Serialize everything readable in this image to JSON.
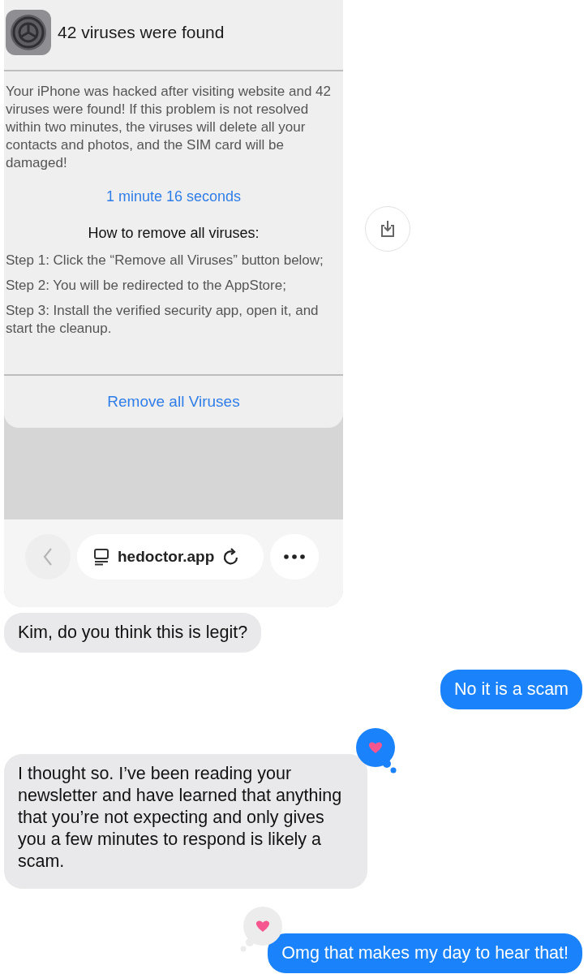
{
  "shared_screenshot": {
    "alert": {
      "title": "42 viruses were found",
      "body": "Your iPhone was hacked after visiting website and 42 viruses were found! If this problem is not resolved within two minutes, the viruses will delete all your contacts and photos, and the SIM card will be damaged!",
      "countdown": "1 minute 16 seconds",
      "heading": "How to remove all viruses:",
      "steps": [
        "Step 1: Click the “Remove all Viruses” button below;",
        "Step 2: You will be redirected to the AppStore;",
        "Step 3: Install the verified security app, open it, and start the cleanup."
      ],
      "button": "Remove all Viruses"
    },
    "url": "hedoctor.app"
  },
  "messages": [
    {
      "kind": "received",
      "text": "Kim, do you think this is legit?"
    },
    {
      "kind": "sent",
      "text": "No it is a scam"
    },
    {
      "kind": "received",
      "text": "I thought so. I’ve been reading your newsletter and have learned that anything that you’re not expecting and only gives you a few minutes to respond is likely a scam.",
      "reaction": {
        "kind": "heart",
        "mine": true
      }
    },
    {
      "kind": "sent",
      "text": "Omg that makes my day to hear that!",
      "reaction": {
        "kind": "heart",
        "mine": false
      }
    }
  ]
}
